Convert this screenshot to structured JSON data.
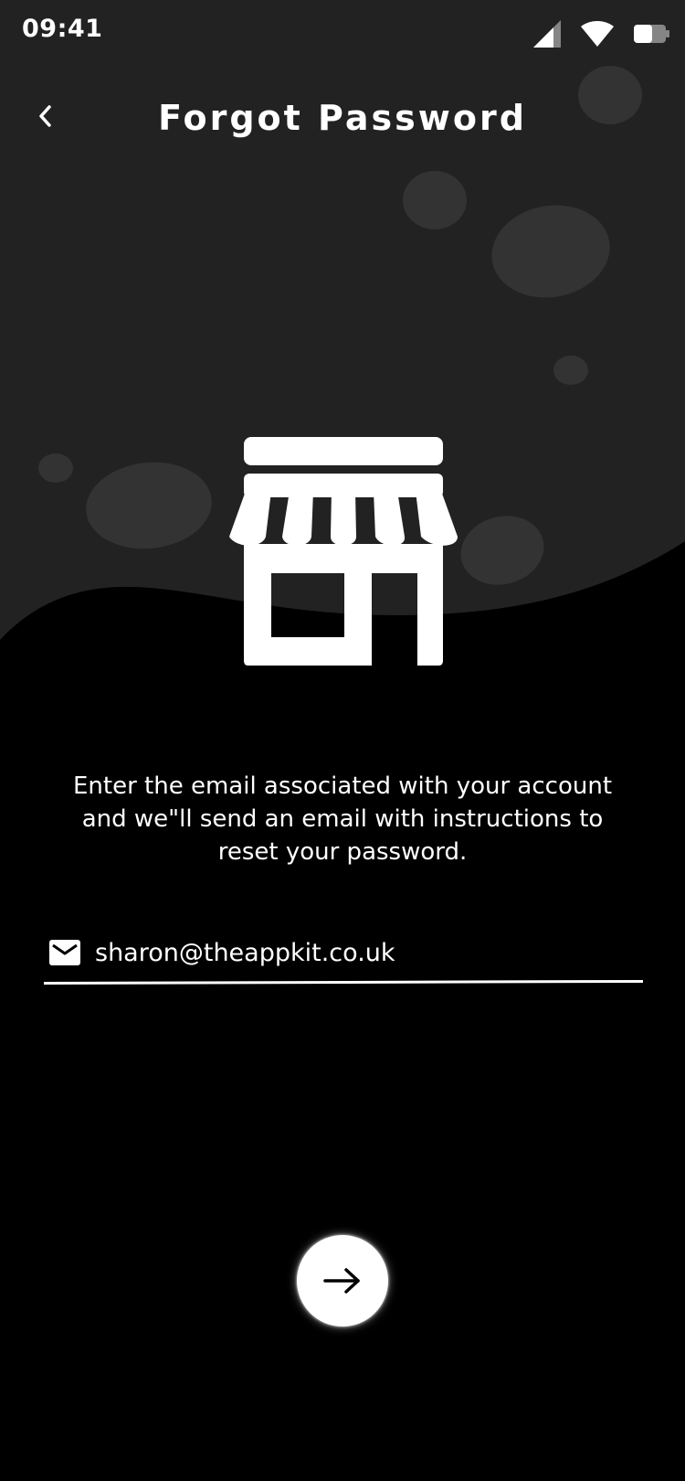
{
  "status_bar": {
    "time": "09:41",
    "icons": [
      "cellular-signal-icon",
      "wifi-icon",
      "battery-icon"
    ]
  },
  "header": {
    "title": "Forgot Password",
    "back_icon": "chevron-left-icon"
  },
  "illustration": {
    "icon": "storefront-icon"
  },
  "instructions": {
    "text": "Enter the email associated with your account and we\"ll send an email with instructions to reset your password."
  },
  "email_field": {
    "icon": "mail-icon",
    "value": "sharon@theappkit.co.uk"
  },
  "submit": {
    "icon": "arrow-right-icon"
  },
  "colors": {
    "background": "#000000",
    "top_panel": "#222222",
    "blob": "#333333",
    "foreground": "#ffffff"
  }
}
